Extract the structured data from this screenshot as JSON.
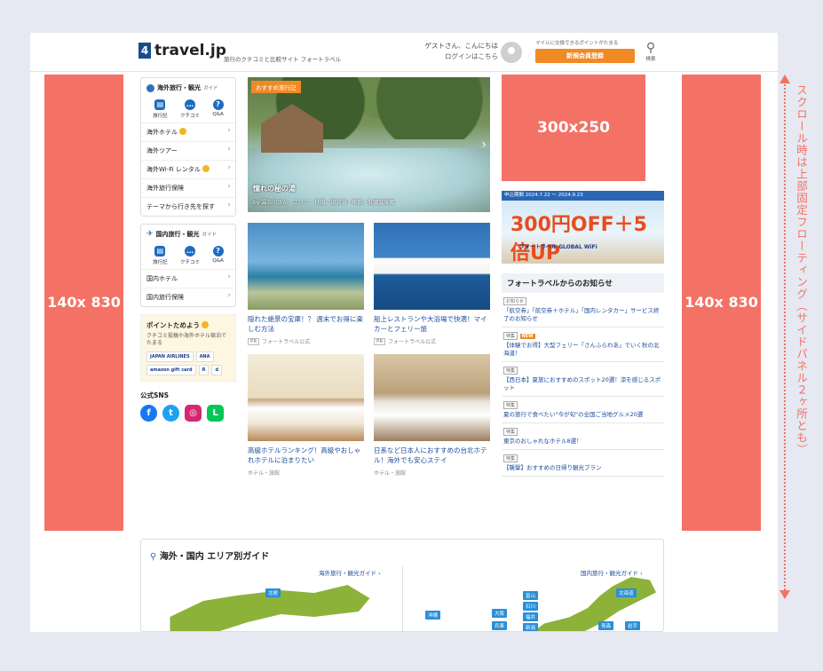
{
  "header": {
    "logo_mark": "4",
    "logo_text": "travel.jp",
    "tagline": "旅行のクチコミと比較サイト フォートラベル",
    "greeting": "ゲストさん、こんにちは",
    "login": "ログインはこちら",
    "point_note": "マイルに交換できるポイントがたまる",
    "signup": "新規会員登録",
    "search_label": "検索"
  },
  "ads": {
    "left": "140x 830",
    "right": "140x 830",
    "rect": "300x250"
  },
  "sidebar": {
    "overseas": {
      "title": "海外旅行・観光",
      "title_small": "ガイド",
      "icons": [
        "旅行記",
        "クチコミ",
        "Q&A"
      ],
      "items": [
        "海外ホテル",
        "海外ツアー",
        "海外Wi-Fi レンタル",
        "海外旅行保険",
        "テーマから行き先を探す"
      ]
    },
    "domestic": {
      "title": "国内旅行・観光",
      "title_small": "ガイド",
      "icons": [
        "旅行記",
        "クチコミ",
        "Q&A"
      ],
      "items": [
        "国内ホテル",
        "国内旅行保険"
      ]
    },
    "points": {
      "title": "ポイントためよう",
      "desc": "クチコミ投稿や海外ホテル宿泊でたまる",
      "logos": [
        "JAPAN AIRLINES",
        "ANA",
        "amazon gift card",
        "R",
        "d"
      ]
    },
    "sns_title": "公式SNS"
  },
  "hero": {
    "tag": "おすすめ旅行記",
    "caption": "憧れの秘の湯",
    "sub": "by 湯治川さん　エリア：秋田／田沢湖・角館・乳頭温泉郷"
  },
  "cards": [
    {
      "title": "隠れた絶景の宝庫！？ 週末でお得に楽しむ方法",
      "pr": "PR",
      "meta": "フォートラベル公式"
    },
    {
      "title": "船上レストランや大浴場で快適！マイカーとフェリー旅",
      "pr": "PR",
      "meta": "フォートラベル公式"
    },
    {
      "title": "高級ホテルランキング！高級やおしゃれホテルに泊まりたい",
      "pr": "",
      "meta": "ホテル・旅館"
    },
    {
      "title": "日系など日本人におすすめの台北ホテル！海外でも安心ステイ",
      "pr": "",
      "meta": "ホテル・旅館"
    }
  ],
  "banner": {
    "date": "申込期間 2024.7.22 ～ 2024.9.23",
    "offer": "300円OFF＋5倍UP",
    "offer_sub": "Wi-Fiレンタル ポイント",
    "brand": "フォートラベル GLOBAL WiFi"
  },
  "notice": {
    "title": "フォートラベルからのお知らせ",
    "items": [
      {
        "tag": "お知らせ",
        "new": "",
        "text": "「航空券」「航空券＋ホテル」「国内レンタカー」サービス終了のお知らせ"
      },
      {
        "tag": "特集",
        "new": "NEW",
        "text": "【体験でお得】大型フェリー「さんふらわあ」でいく秋の北海道！"
      },
      {
        "tag": "特集",
        "new": "",
        "text": "【西日本】夏旅におすすめのスポット20選！涼を感じるスポット"
      },
      {
        "tag": "特集",
        "new": "",
        "text": "夏の旅行で食べたい\"今が旬\"の全国ご当地グルメ20選"
      },
      {
        "tag": "特集",
        "new": "",
        "text": "東京のおしゃれなホテル8選！"
      },
      {
        "tag": "特集",
        "new": "",
        "text": "【襲撃】おすすめの日帰り観光プラン"
      }
    ]
  },
  "area": {
    "title": "海外・国内 エリア別ガイド",
    "overseas_link": "海外旅行・観光ガイド ›",
    "domestic_link": "国内旅行・観光ガイド ›",
    "tags": [
      "北極",
      "沖縄",
      "大阪",
      "兵庫",
      "富山",
      "石川",
      "福井",
      "新潟",
      "北海道",
      "青森",
      "岩手"
    ]
  },
  "scroll_note": "スクロール時は上部固定フローティング（サイドパネル２ヶ所とも）",
  "colors": {
    "accent": "#f08a24",
    "ad": "#f47165",
    "link": "#1a4b9c",
    "brand": "#2f6fbf"
  }
}
